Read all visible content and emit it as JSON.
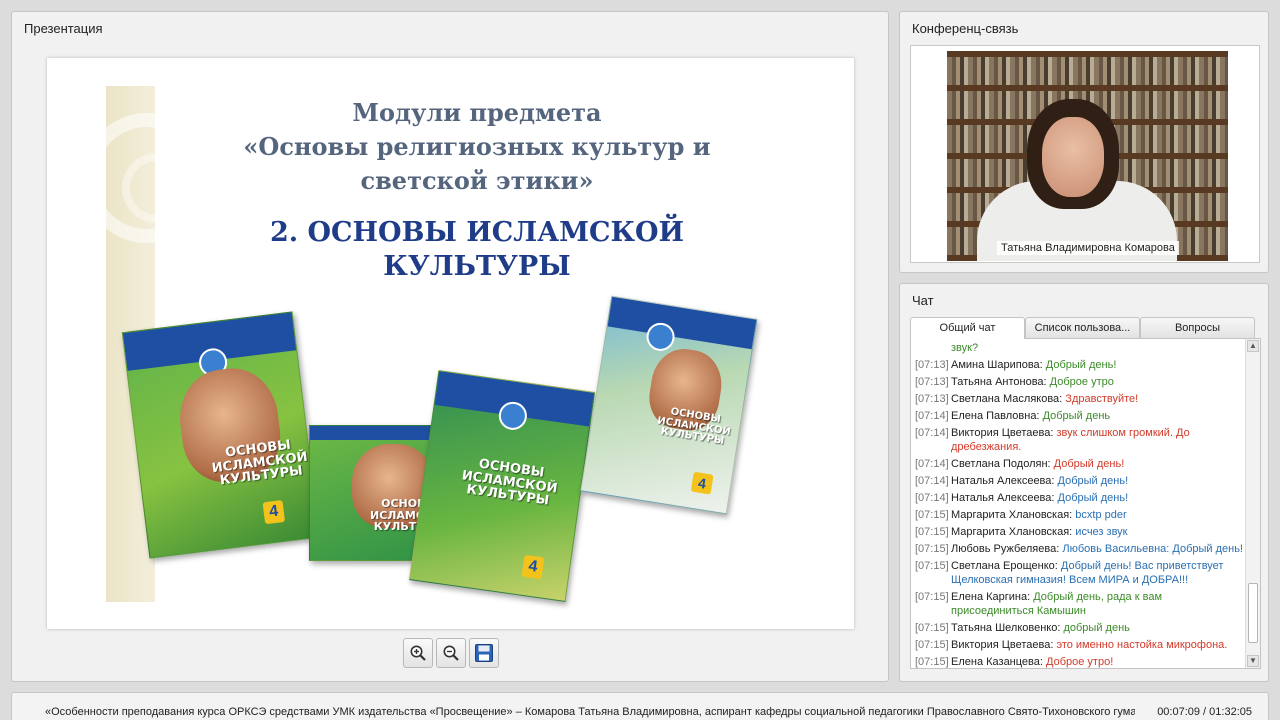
{
  "presentation": {
    "title": "Презентация",
    "slide": {
      "title_lines": [
        "Модули предмета",
        "«Основы религиозных культур и",
        "светской этики»"
      ],
      "subtitle_lines": [
        "2. ОСНОВЫ ИСЛАМСКОЙ",
        "КУЛЬТУРЫ"
      ],
      "book_titles": [
        "ОСНОВЫ ИСЛАМСКОЙ КУЛЬТУРЫ",
        "ОСНОВЫ ИСЛАМСКОЙ КУЛЬТУРЫ",
        "ОСНОВЫ ИСЛАМСКОЙ КУЛЬТУРЫ",
        "ОСНОВЫ ИСЛАМСКОЙ КУЛЬТУРЫ"
      ],
      "book_grade": "4"
    },
    "toolbar": {
      "zoom_in": "zoom-in-icon",
      "zoom_out": "zoom-out-icon",
      "save": "save-icon"
    }
  },
  "conference": {
    "title": "Конференц-связь",
    "speaker_name": "Татьяна Владимировна Комарова"
  },
  "chat": {
    "title": "Чат",
    "tabs": [
      "Общий чат",
      "Список пользова...",
      "Вопросы"
    ],
    "top_fragment": "звук?",
    "messages": [
      {
        "time": "[07:13]",
        "author": "Амина Шарипова:",
        "text": "Добрый день!",
        "color": "green"
      },
      {
        "time": "[07:13]",
        "author": "Татьяна Антонова:",
        "text": "Доброе утро",
        "color": "green"
      },
      {
        "time": "[07:13]",
        "author": "Светлана Маслякова:",
        "text": "Здравствуйте!",
        "color": "red"
      },
      {
        "time": "[07:14]",
        "author": "Елена Павловна:",
        "text": "Добрый день",
        "color": "green"
      },
      {
        "time": "[07:14]",
        "author": "Виктория Цветаева:",
        "text": "звук слишком громкий. До дребезжания.",
        "color": "red"
      },
      {
        "time": "[07:14]",
        "author": "Светлана Подолян:",
        "text": "Добрый день!",
        "color": "red"
      },
      {
        "time": "[07:14]",
        "author": "Наталья Алексеева:",
        "text": "Добрый день!",
        "color": "blue"
      },
      {
        "time": "[07:14]",
        "author": "Наталья Алексеева:",
        "text": "Добрый день!",
        "color": "blue"
      },
      {
        "time": "[07:15]",
        "author": "Маргарита Хлановская:",
        "text": "bcxtp pder",
        "color": "blue"
      },
      {
        "time": "[07:15]",
        "author": "Маргарита Хлановская:",
        "text": "исчез звук",
        "color": "blue"
      },
      {
        "time": "[07:15]",
        "author": "Любовь Ружбеляева:",
        "text": "Любовь Васильевна: Добрый день!",
        "color": "blue"
      },
      {
        "time": "[07:15]",
        "author": "Светлана Ерощенко:",
        "text": "Добрый день! Вас приветствует Щелковская гимназия! Всем МИРА и ДОБРА!!!",
        "color": "blue"
      },
      {
        "time": "[07:15]",
        "author": "Елена Каргина:",
        "text": "Добрый день, рада к вам присоединиться Камышин",
        "color": "green"
      },
      {
        "time": "[07:15]",
        "author": "Татьяна Шелковенко:",
        "text": "добрый день",
        "color": "green"
      },
      {
        "time": "[07:15]",
        "author": "Виктория Цветаева:",
        "text": "это именно настойка микрофона.",
        "color": "red"
      },
      {
        "time": "[07:15]",
        "author": "Елена Казанцева:",
        "text": "Доброе утро!",
        "color": "red"
      }
    ]
  },
  "status": {
    "text": "«Особенности преподавания курса ОРКСЭ средствами УМК издательства «Просвещение» – Комарова Татьяна Владимировна, аспирант кафедры социальной педагогики Православного Свято-Тихоновского гуманитарного ун",
    "time": "00:07:09 / 01:32:05"
  }
}
